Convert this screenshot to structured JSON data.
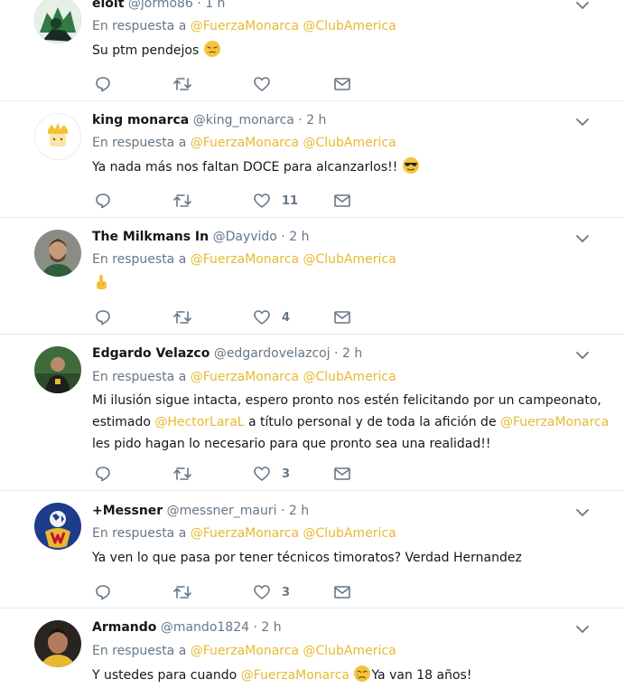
{
  "reply_prefix": "En respuesta a",
  "tweets": [
    {
      "name": "eloit",
      "handle": "@jormo86",
      "time": "1 h",
      "mentions": [
        "@FuerzaMonarca",
        "@ClubAmerica"
      ],
      "text": "Su ptm pendejos",
      "emoji": "pensive-face",
      "counts": {
        "like": ""
      }
    },
    {
      "name": "king monarca",
      "handle": "@king_monarca",
      "time": "2 h",
      "mentions": [
        "@FuerzaMonarca",
        "@ClubAmerica"
      ],
      "text": "Ya nada más nos faltan DOCE para alcanzarlos!!",
      "emoji": "sunglasses-face",
      "counts": {
        "like": "11"
      }
    },
    {
      "name": "The Milkmans In",
      "handle": "@Dayvido",
      "time": "2 h",
      "mentions": [
        "@FuerzaMonarca",
        "@ClubAmerica"
      ],
      "text": "",
      "emoji": "middle-finger",
      "counts": {
        "like": "4"
      }
    },
    {
      "name": "Edgardo Velazco",
      "handle": "@edgardovelazcoj",
      "time": "2 h",
      "mentions": [
        "@FuerzaMonarca",
        "@ClubAmerica"
      ],
      "text_parts": [
        "Mi ilusión sigue intacta, espero pronto nos estén felicitando por un campeonato, estimado ",
        "@HectorLaraL",
        " a título personal y de toda la afición de ",
        "@FuerzaMonarca",
        " les pido hagan lo necesario para que pronto sea una realidad!!"
      ],
      "counts": {
        "like": "3"
      }
    },
    {
      "name": "+Messner",
      "handle": "@messner_mauri",
      "time": "2 h",
      "mentions": [
        "@FuerzaMonarca",
        "@ClubAmerica"
      ],
      "text": "Ya ven lo que pasa por tener técnicos timoratos? Verdad Hernandez",
      "counts": {
        "like": "3"
      }
    },
    {
      "name": "Armando",
      "handle": "@mando1824",
      "time": "2 h",
      "mentions": [
        "@FuerzaMonarca",
        "@ClubAmerica"
      ],
      "text_parts": [
        "Y ustedes para cuando ",
        "@FuerzaMonarca",
        "Ya van 18 años!"
      ],
      "emoji": "crying-face"
    }
  ],
  "colors": {
    "mention": "#e8b930",
    "secondary_text": "#657786",
    "divider": "#e6ecf0"
  },
  "icons": [
    "reply-icon",
    "retweet-icon",
    "like-icon",
    "message-icon",
    "caret-down-icon"
  ]
}
